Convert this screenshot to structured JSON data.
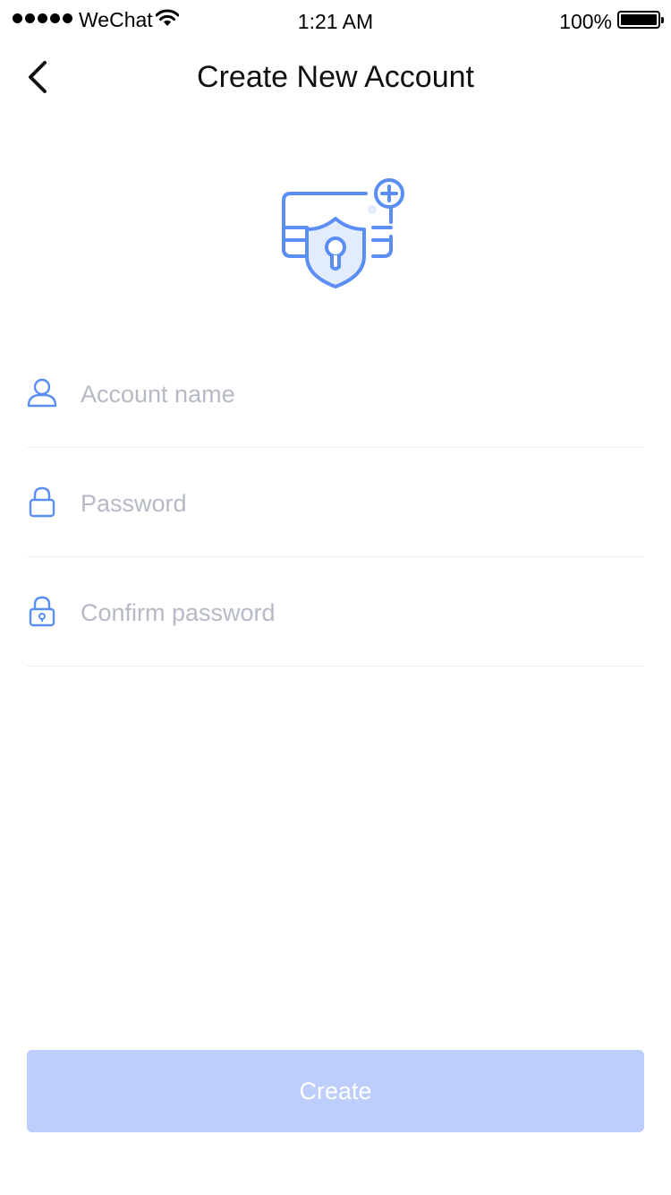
{
  "status_bar": {
    "carrier": "WeChat",
    "time": "1:21 AM",
    "battery": "100%",
    "icons": [
      "signal-dots-icon",
      "wifi-icon",
      "battery-icon"
    ]
  },
  "nav": {
    "title": "Create New Account",
    "back_icon": "chevron-left-icon"
  },
  "hero": {
    "icon": "account-shield-add-icon"
  },
  "form": {
    "fields": [
      {
        "icon": "user-icon",
        "value": "",
        "placeholder": "Account name"
      },
      {
        "icon": "lock-icon",
        "value": "",
        "placeholder": "Password"
      },
      {
        "icon": "lock-keyhole-icon",
        "value": "",
        "placeholder": "Confirm password"
      }
    ]
  },
  "actions": {
    "create_label": "Create"
  },
  "colors": {
    "accent": "#5b8ef5",
    "accent_light": "#e3ecfd",
    "button_disabled": "#bdcefc",
    "placeholder": "#b6b9c6",
    "divider": "#ebedf2"
  }
}
